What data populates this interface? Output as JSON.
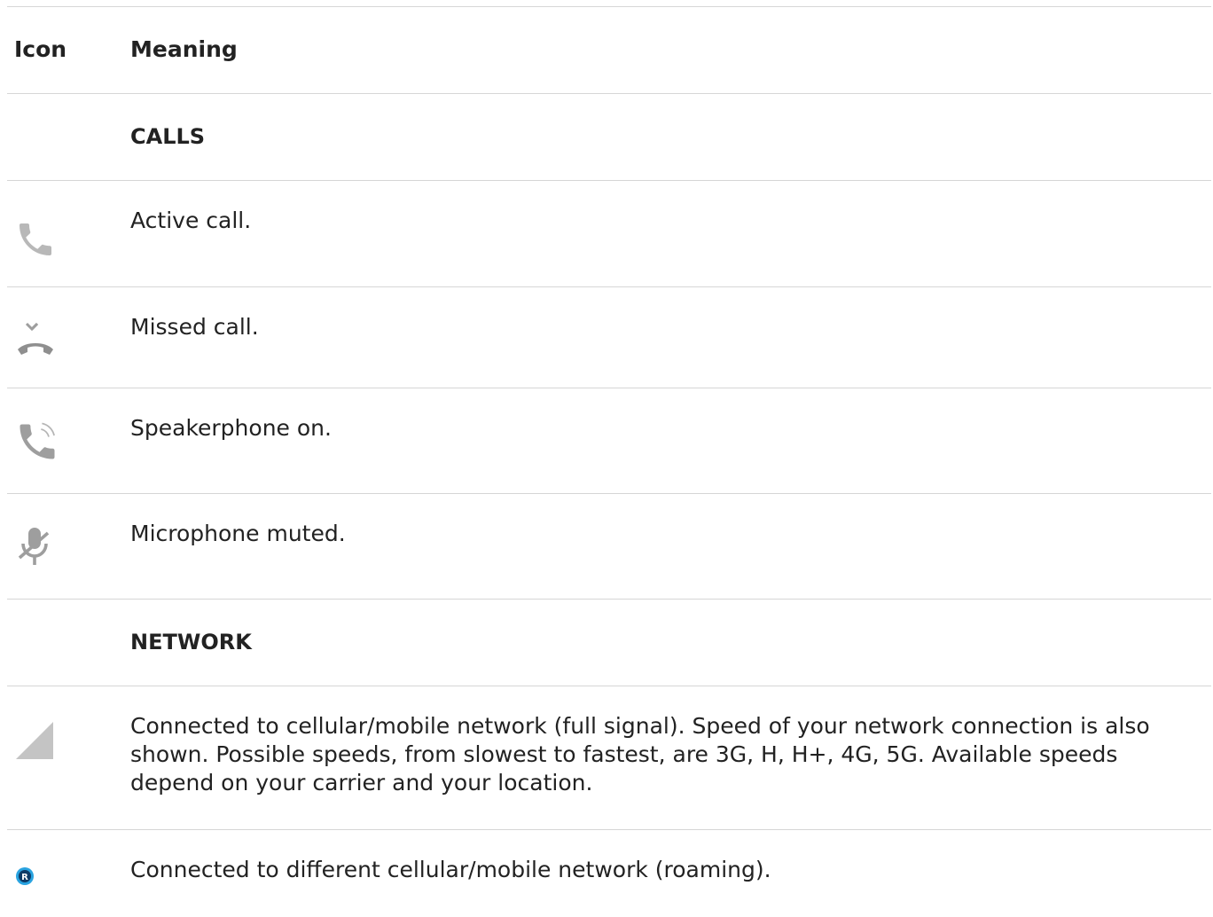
{
  "table": {
    "header": {
      "icon": "Icon",
      "meaning": "Meaning"
    },
    "sections": [
      {
        "title": "CALLS",
        "rows": [
          {
            "icon": "phone-icon",
            "meaning": "Active call."
          },
          {
            "icon": "missed-call-icon",
            "meaning": "Missed call."
          },
          {
            "icon": "speakerphone-icon",
            "meaning": "Speakerphone on."
          },
          {
            "icon": "mic-muted-icon",
            "meaning": "Microphone muted."
          }
        ]
      },
      {
        "title": "NETWORK",
        "rows": [
          {
            "icon": "signal-full-icon",
            "meaning": "Connected to cellular/mobile network (full signal). Speed of your network connection is also shown. Possible speeds, from slowest to fastest, are 3G, H, H+, 4G, 5G. Available speeds depend on your carrier and your location."
          },
          {
            "icon": "roaming-icon",
            "meaning": "Connected to different cellular/mobile network (roaming)."
          }
        ]
      }
    ]
  },
  "colors": {
    "icon_gray": "#9e9e9e",
    "roaming_blue": "#1e88e5",
    "divider": "#d6d6d6"
  }
}
